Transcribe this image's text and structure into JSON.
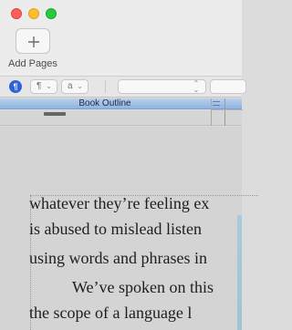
{
  "toolbar": {
    "add_pages_label": "Add Pages",
    "add_icon": "plus-icon"
  },
  "format_bar": {
    "paragraph_icon": "¶",
    "style_popup": "¶",
    "char_style_popup": "a",
    "font_popup": "",
    "size_popup": ""
  },
  "outline": {
    "title": "Book Outline"
  },
  "document": {
    "lines": [
      "whatever they’re feeling ex",
      "is abused to mislead listen",
      "using words and phrases in",
      "We’ve spoken on this",
      "the scope of a language l"
    ]
  },
  "colors": {
    "accent": "#2a64d8",
    "outline_header": "#a8c4e6",
    "close": "#fe5f57",
    "minimize": "#febc2e",
    "maximize": "#28c840"
  }
}
